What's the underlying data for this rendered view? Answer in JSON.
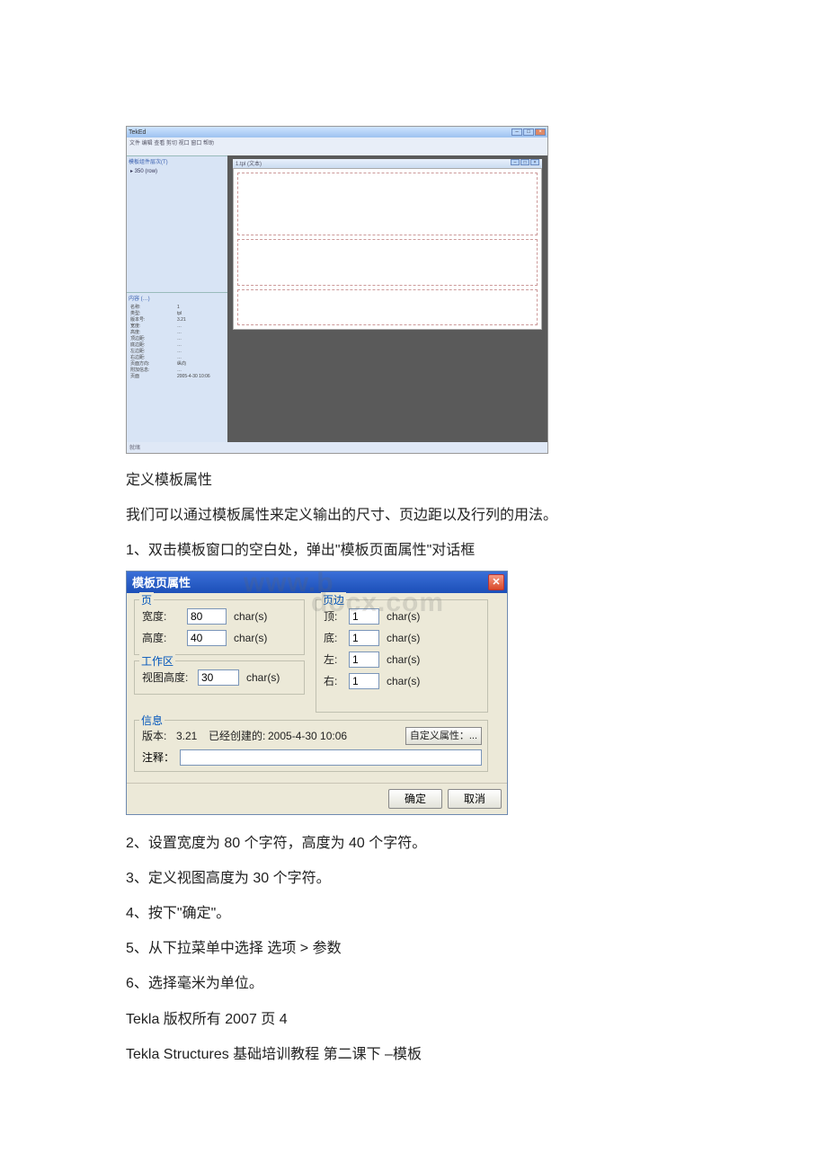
{
  "editor": {
    "app_title": "TekEd",
    "menubar": "文件 编辑 查看 剪切 视口 窗口 帮助",
    "toolbar_left": "",
    "doc_title": "1.tpl (文本)",
    "tree_root": "▸ 350 (row)",
    "left_sec1": "模板组件层次(T)",
    "left_sec2": "内容 (…)",
    "props_left": "名称:\n类型:\n版本号:\n宽度:\n高度:\n顶边距:\n底边距:\n左边距:\n右边距:\n页面方向:\n附加信息:\n页面",
    "props_right": "1\ntpl\n3.21\n…\n…\n…\n…\n…\n…\n纵向\n…\n2005-4-30 10:06",
    "status": "就绪",
    "doc_wbtns": "□"
  },
  "body": {
    "p1": "定义模板属性",
    "p2": "我们可以通过模板属性来定义输出的尺寸、页边距以及行列的用法。",
    "p3": "1、双击模板窗口的空白处，弹出\"模板页面属性\"对话框",
    "p4": "2、设置宽度为 80 个字符，高度为 40 个字符。",
    "p5": "3、定义视图高度为 30 个字符。",
    "p6": "4、按下\"确定\"。",
    "p7": "5、从下拉菜单中选择 选项 > 参数",
    "p8": "6、选择毫米为单位。",
    "p9": "Tekla 版权所有 2007 页 4",
    "p10": "Tekla Structures 基础培训教程 第二课下 –模板"
  },
  "dialog": {
    "title": "模板页属性",
    "watermark1": "www.b",
    "watermark2": "docx.com",
    "legend_page": "页",
    "legend_margin": "页边",
    "legend_work": "工作区",
    "legend_info": "信息",
    "width_label": "宽度:",
    "width_value": "80",
    "width_unit": "char(s)",
    "height_label": "高度:",
    "height_value": "40",
    "height_unit": "char(s)",
    "view_label": "视图高度:",
    "view_value": "30",
    "view_unit": "char(s)",
    "top_label": "顶:",
    "top_value": "1",
    "bottom_label": "底:",
    "bottom_value": "1",
    "left_label": "左:",
    "left_value": "1",
    "right_label": "右:",
    "right_value": "1",
    "unit": "char(s)",
    "version_label": "版本:",
    "version_value": "3.21",
    "created_label": "已经创建的:",
    "created_value": "2005-4-30 10:06",
    "custom_btn": "自定义属性：...",
    "comment_label": "注释：",
    "ok": "确定",
    "cancel": "取消"
  }
}
